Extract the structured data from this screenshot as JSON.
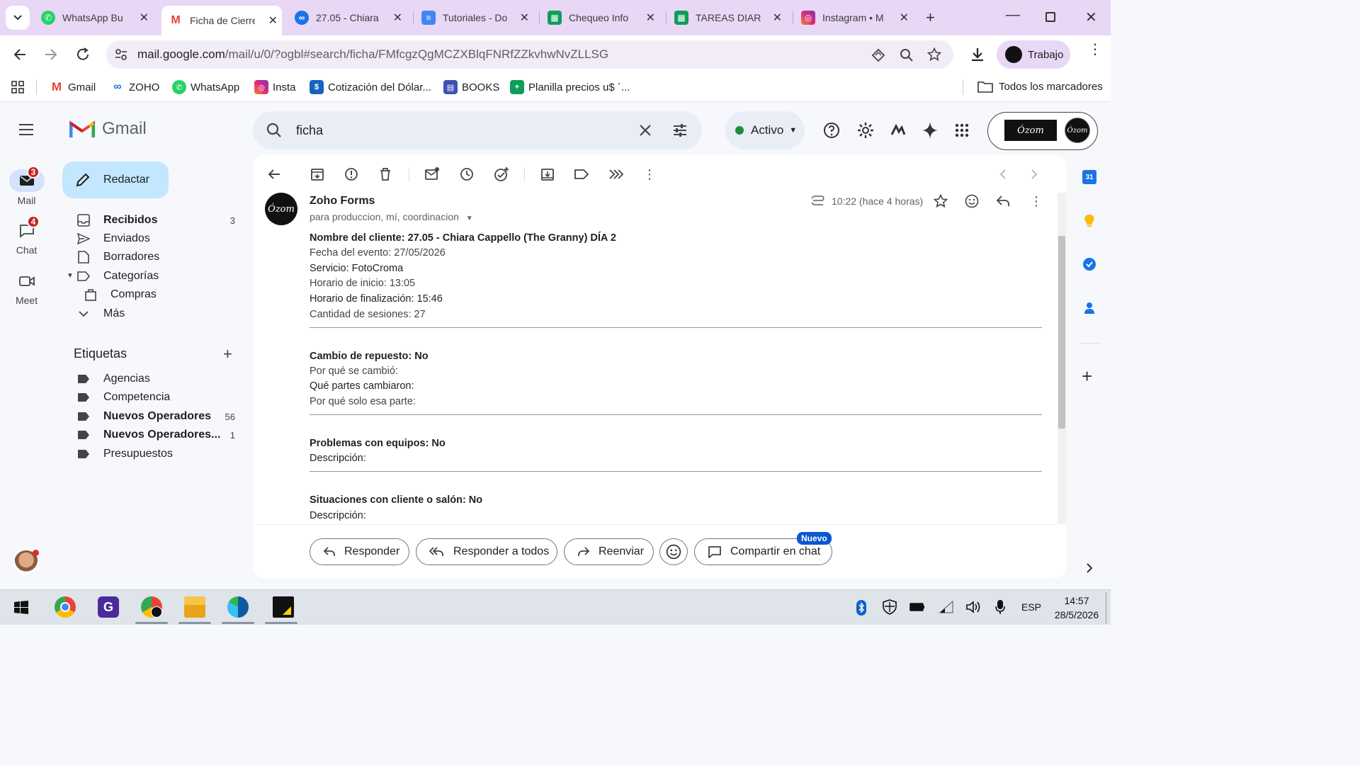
{
  "browser": {
    "tabs": [
      {
        "title": "WhatsApp Bu",
        "icon": "whatsapp-icon",
        "color": "#25d366"
      },
      {
        "title": "Ficha de Cierre",
        "icon": "gmail-icon",
        "color": "#ea4335",
        "active": true
      },
      {
        "title": "27.05 - Chiara",
        "icon": "link-icon",
        "color": "#1a73e8"
      },
      {
        "title": "Tutoriales - Do",
        "icon": "docs-icon",
        "color": "#4285f4"
      },
      {
        "title": "Chequeo Info",
        "icon": "sheets-icon",
        "color": "#0f9d58"
      },
      {
        "title": "TAREAS DIARI",
        "icon": "sheets-icon",
        "color": "#0f9d58"
      },
      {
        "title": "Instagram • M",
        "icon": "instagram-icon",
        "color": "#e1306c"
      }
    ],
    "url_host": "mail.google.com",
    "url_path": "/mail/u/0/?ogbl#search/ficha/FMfcgzQgMCZXBlqFNRfZZkvhwNvZLLSG",
    "profile_label": "Trabajo",
    "bookmarks": [
      {
        "label": "Gmail",
        "icon": "gmail-icon",
        "color": "#ea4335"
      },
      {
        "label": "ZOHO",
        "icon": "zoho-icon",
        "color": "#1a73e8"
      },
      {
        "label": "WhatsApp",
        "icon": "whatsapp-icon",
        "color": "#25d366"
      },
      {
        "label": "Insta",
        "icon": "instagram-icon",
        "color": "#e1306c"
      },
      {
        "label": "Cotización del Dólar...",
        "icon": "dolar-icon",
        "color": "#1565c0"
      },
      {
        "label": "BOOKS",
        "icon": "books-icon",
        "color": "#3f51b5"
      },
      {
        "label": "Planilla precios u$ ´...",
        "icon": "sheets-icon",
        "color": "#0f9d58"
      }
    ],
    "all_bookmarks": "Todos los marcadores"
  },
  "gmail": {
    "logo_text": "Gmail",
    "rail": [
      {
        "label": "Mail",
        "badge": "3"
      },
      {
        "label": "Chat",
        "badge": "4"
      },
      {
        "label": "Meet",
        "badge": ""
      }
    ],
    "compose_label": "Redactar",
    "nav": [
      {
        "label": "Recibidos",
        "count": "3",
        "bold": true
      },
      {
        "label": "Enviados",
        "count": ""
      },
      {
        "label": "Borradores",
        "count": ""
      },
      {
        "label": "Categorías",
        "count": ""
      },
      {
        "label": "Compras",
        "count": ""
      },
      {
        "label": "Más",
        "count": ""
      }
    ],
    "labels_title": "Etiquetas",
    "labels": [
      {
        "label": "Agencias",
        "count": ""
      },
      {
        "label": "Competencia",
        "count": ""
      },
      {
        "label": "Nuevos Operadores",
        "count": "56",
        "bold": true
      },
      {
        "label": "Nuevos Operadores...",
        "count": "1",
        "bold": true
      },
      {
        "label": "Presupuestos",
        "count": ""
      }
    ],
    "search_value": "ficha",
    "status_label": "Activo",
    "account_brand": "Ózom"
  },
  "message": {
    "sender": "Zoho Forms",
    "recipients": "para produccion, mí, coordinacion",
    "time": "10:22 (hace 4 horas)",
    "avatar_text": "Ózom",
    "lines": [
      {
        "text": "Nombre del cliente: 27.05 - Chiara Cappello (The Granny) DÍA 2",
        "style": "b"
      },
      {
        "text": "Fecha del evento: 27/05/2026",
        "style": "grey"
      },
      {
        "text": "Servicio: FotoCroma",
        "style": ""
      },
      {
        "text": "Horario de inicio: 13:05",
        "style": "grey"
      },
      {
        "text": "Horario de finalización: 15:46",
        "style": ""
      },
      {
        "text": "Cantidad de sesiones: 27",
        "style": "grey"
      },
      {
        "text": "Cambio de repuesto: No",
        "style": "b"
      },
      {
        "text": "Por qué se cambió:",
        "style": "grey"
      },
      {
        "text": "Qué partes cambiaron:",
        "style": ""
      },
      {
        "text": "Por qué solo esa parte:",
        "style": "grey"
      },
      {
        "text": "Problemas con equipos: No",
        "style": "b"
      },
      {
        "text": "Descripción:",
        "style": ""
      },
      {
        "text": "Situaciones con cliente o salón: No",
        "style": "b"
      },
      {
        "text": "Descripción:",
        "style": ""
      }
    ],
    "actions": {
      "reply": "Responder",
      "reply_all": "Responder a todos",
      "forward": "Reenviar",
      "share_chat": "Compartir en chat",
      "new_badge": "Nuevo"
    }
  },
  "taskbar": {
    "time": "14:57",
    "date": "28/5/2026",
    "lang": "ESP"
  }
}
